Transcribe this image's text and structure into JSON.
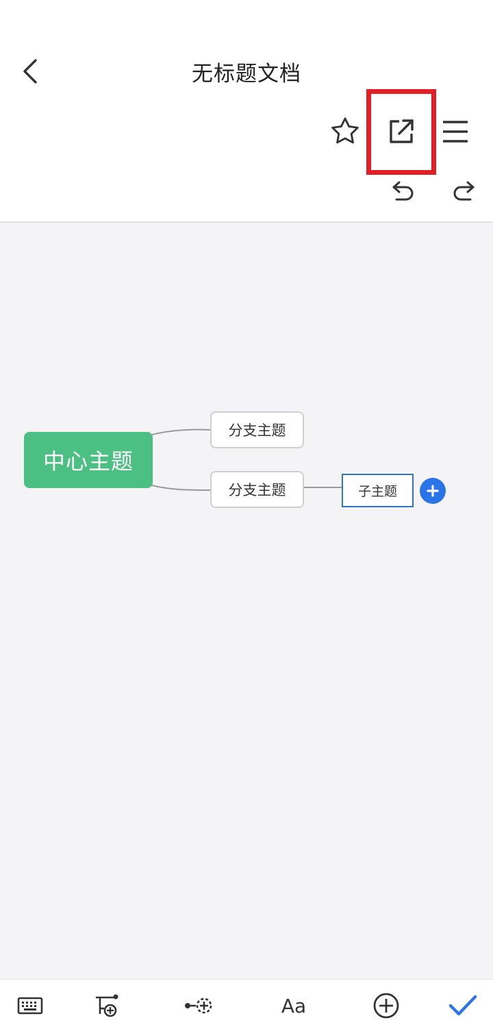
{
  "header": {
    "title": "无标题文档",
    "icons": {
      "back": "chevron-left-icon",
      "favorite": "star-icon",
      "share": "external-link-icon",
      "menu": "hamburger-menu-icon",
      "undo": "undo-icon",
      "redo": "redo-icon"
    },
    "highlight_color": "#e02026"
  },
  "mindmap": {
    "center": {
      "label": "中心主题",
      "color": "#4cbf82"
    },
    "branches": [
      {
        "label": "分支主题"
      },
      {
        "label": "分支主题",
        "children": [
          {
            "label": "子主题",
            "selected": true
          }
        ]
      }
    ],
    "selection_color": "#2f73c9",
    "add_button_color": "#2a73e8",
    "canvas_color": "#f4f4f6"
  },
  "toolbar": {
    "text_style_label": "Aa",
    "icons": [
      "keyboard-icon",
      "add-child-topic-icon",
      "add-sibling-topic-icon",
      "text-style-icon",
      "insert-icon",
      "checkmark-icon"
    ],
    "accent": "#2a73e8"
  }
}
